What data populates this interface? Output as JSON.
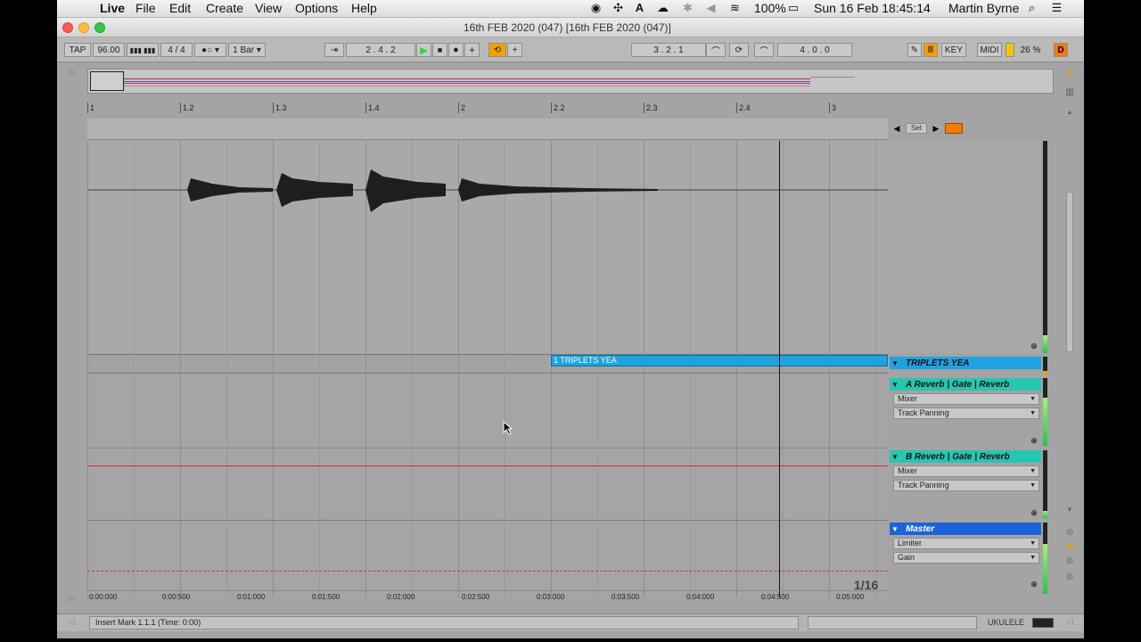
{
  "menubar": {
    "app": "Live",
    "menus": [
      "File",
      "Edit",
      "Create",
      "View",
      "Options",
      "Help"
    ],
    "battery": "100%",
    "datetime": "Sun 16 Feb  18:45:14",
    "user": "Martin Byrne"
  },
  "window": {
    "title": "16th FEB 2020 (047)  [16th FEB 2020 (047)]"
  },
  "transport": {
    "tap": "TAP",
    "tempo": "96.00",
    "signature": "4 / 4",
    "quantize": "1 Bar",
    "position": "2 .  4 .  2",
    "loop_start": "3 .  2 .  1",
    "loop_length": "4 .  0 .  0",
    "key": "KEY",
    "midi": "MIDI",
    "cpu": "26 %",
    "d_label": "D"
  },
  "ruler": {
    "labels": [
      "1",
      "1.2",
      "1.3",
      "1.4",
      "2",
      "2.2",
      "2.3",
      "2.4",
      "3"
    ]
  },
  "setbar": {
    "set_label": "Set"
  },
  "clip": {
    "label": "1 TRIPLETS YEA"
  },
  "tracks": [
    {
      "name": "TRIPLETS YEA",
      "color": "#1fa3e0",
      "devices": []
    },
    {
      "name": "A Reverb | Gate | Reverb",
      "color": "#25c7b0",
      "devices": [
        "Mixer",
        "Track Panning"
      ]
    },
    {
      "name": "B Reverb | Gate | Reverb",
      "color": "#25c7b0",
      "devices": [
        "Mixer",
        "Track Panning"
      ]
    },
    {
      "name": "Master",
      "color": "#1d63d8",
      "devices": [
        "Limiter",
        "Gain"
      ]
    }
  ],
  "grid_quant": "1/16",
  "time_ruler": {
    "labels": [
      "0:00:000",
      "0:00:500",
      "0:01:000",
      "0:01:500",
      "0:02:000",
      "0:02:500",
      "0:03:000",
      "0:03:500",
      "0:04:000",
      "0:04:500",
      "0:05:000"
    ]
  },
  "status": {
    "message": "Insert Mark 1.1.1 (Time: 0:00)",
    "track_name": "UKULELE"
  },
  "colors": {
    "accent_orange": "#f5a000",
    "play_green": "#3fcc3f",
    "clip_blue": "#1fa3e0",
    "return_teal": "#25c7b0",
    "master_blue": "#1d63d8",
    "automation_red": "#d23030"
  }
}
